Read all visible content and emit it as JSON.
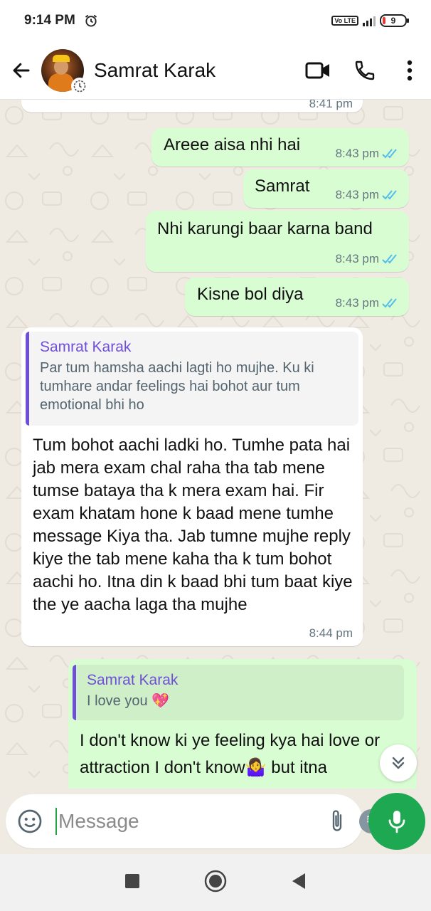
{
  "status_bar": {
    "time": "9:14 PM",
    "network": "Vo LTE",
    "battery": "9"
  },
  "header": {
    "contact_name": "Samrat Karak"
  },
  "messages": [
    {
      "time": "8:41 pm"
    },
    {
      "text": "Areee aisa nhi hai",
      "time": "8:43 pm"
    },
    {
      "text": "Samrat",
      "time": "8:43 pm"
    },
    {
      "text": "Nhi karungi baar karna band",
      "time": "8:43 pm"
    },
    {
      "text": "Kisne bol diya",
      "time": "8:43 pm"
    },
    {
      "quote_name": "Samrat Karak",
      "quote_text": "Par tum hamsha aachi lagti ho mujhe.  Ku ki tumhare andar feelings hai bohot aur tum emotional bhi ho",
      "text": "Tum bohot aachi ladki ho. Tumhe pata hai jab mera exam chal raha tha tab mene tumse bataya tha k mera exam hai. Fir exam khatam hone k baad mene tumhe message Kiya tha. Jab tumne mujhe reply kiye the tab mene kaha tha k tum bohot aachi ho. Itna din k baad bhi tum baat kiye the ye aacha laga tha mujhe",
      "time": "8:44 pm"
    },
    {
      "quote_name": "Samrat Karak",
      "quote_text": "I love you 💖",
      "text": "I don't know ki ye feeling kya hai love or attraction I don't know🤷‍♀️ but itna"
    }
  ],
  "composer": {
    "placeholder": "Message"
  },
  "colors": {
    "outgoing": "#d9fdd3",
    "incoming": "#ffffff",
    "accent": "#1da851",
    "tick": "#53bdeb",
    "quote_bar": "#6f4fd8"
  },
  "icons": [
    "alarm-icon",
    "back-arrow-icon",
    "video-call-icon",
    "voice-call-icon",
    "more-options-icon",
    "double-check-icon",
    "chevron-double-down-icon",
    "emoji-icon",
    "attach-icon",
    "rupee-icon",
    "camera-icon",
    "mic-icon",
    "nav-recents-icon",
    "nav-home-icon",
    "nav-back-icon"
  ]
}
